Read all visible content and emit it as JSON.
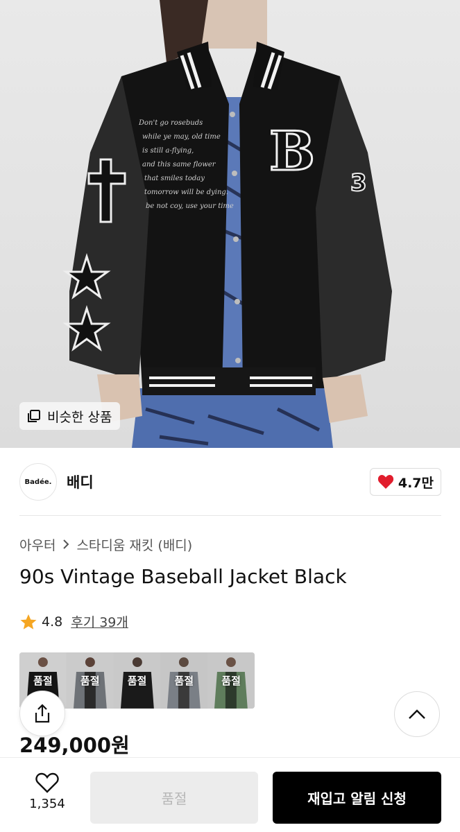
{
  "hero": {
    "similar_label": "비슷한 상품"
  },
  "brand": {
    "logo_text": "Badée.",
    "name": "배디",
    "likes": "4.7만"
  },
  "breadcrumb": {
    "category": "아우터",
    "subcategory": "스타디움 재킷 (배디)"
  },
  "product": {
    "title": "90s Vintage Baseball Jacket Black",
    "rating": "4.8",
    "reviews": "후기 39개",
    "price": "249,000원"
  },
  "options": [
    {
      "label": "품절"
    },
    {
      "label": "품절"
    },
    {
      "label": "품절"
    },
    {
      "label": "품절"
    },
    {
      "label": "품절"
    }
  ],
  "bottom": {
    "wish_count": "1,354",
    "soldout_button": "품절",
    "notify_button": "재입고 알림 신청"
  },
  "colors": {
    "heart": "#e11d2d",
    "star": "#f5a623",
    "primary_button": "#000000"
  }
}
